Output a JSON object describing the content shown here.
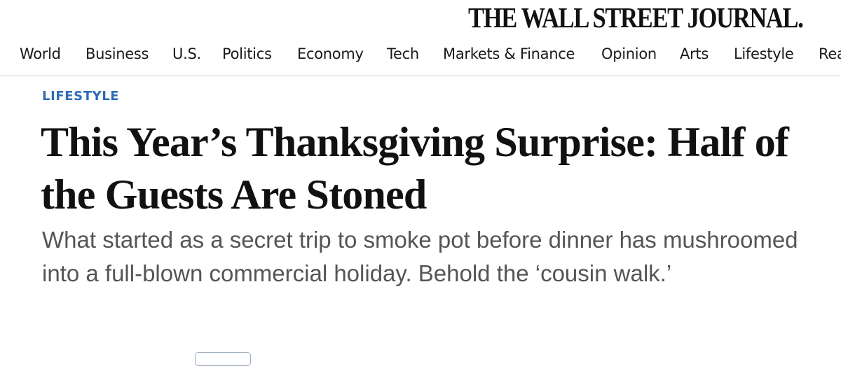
{
  "masthead": {
    "title": "THE WALL STREET JOURNAL."
  },
  "nav": {
    "items": [
      {
        "label": "World"
      },
      {
        "label": "Business"
      },
      {
        "label": "U.S."
      },
      {
        "label": "Politics"
      },
      {
        "label": "Economy"
      },
      {
        "label": "Tech"
      },
      {
        "label": "Markets & Finance"
      },
      {
        "label": "Opinion"
      },
      {
        "label": "Arts"
      },
      {
        "label": "Lifestyle"
      },
      {
        "label": "Rea"
      }
    ]
  },
  "article": {
    "kicker": "LIFESTYLE",
    "headline": "This Year’s Thanksgiving Surprise: Half of the Guests Are Stoned",
    "dek": "What started as a secret trip to smoke pot before dinner has mushroomed into a full-blown commercial holiday. Behold the ‘cousin walk.’"
  },
  "colors": {
    "kicker": "#2d6cb4",
    "dek": "#555555",
    "divider": "#d6d6d6"
  }
}
